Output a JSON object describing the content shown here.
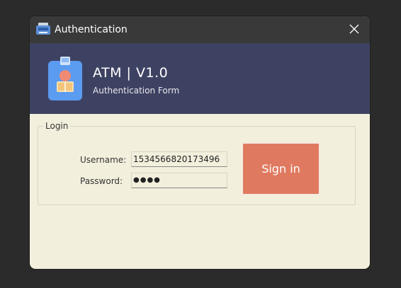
{
  "window": {
    "title": "Authentication",
    "close_icon": "close-icon",
    "app_icon": "atm-icon"
  },
  "header": {
    "title": "ATM | V1.0",
    "subtitle": "Authentication Form",
    "icon": "id-badge-icon"
  },
  "login": {
    "group_label": "Login",
    "username_label": "Username:",
    "username_value": "1534566820173496",
    "password_label": "Password:",
    "password_value": "●●●●",
    "signin_label": "Sign in"
  },
  "colors": {
    "background": "#2b2b2b",
    "titlebar": "#393939",
    "header": "#3e4262",
    "form_background": "#f3efdd",
    "signin_button": "#df7a60"
  }
}
